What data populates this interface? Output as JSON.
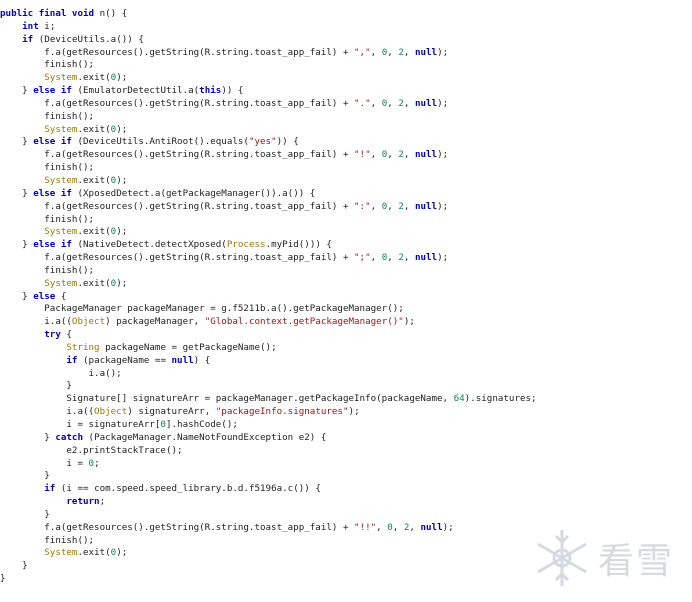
{
  "code": {
    "lines": [
      [
        {
          "t": "kw",
          "v": "public final void"
        },
        {
          "t": "fn",
          "v": " n() {"
        }
      ],
      [
        {
          "t": "fn",
          "v": "    "
        },
        {
          "t": "kw",
          "v": "int"
        },
        {
          "t": "fn",
          "v": " i;"
        }
      ],
      [
        {
          "t": "fn",
          "v": "    "
        },
        {
          "t": "kw",
          "v": "if"
        },
        {
          "t": "fn",
          "v": " (DeviceUtils.a()) {"
        }
      ],
      [
        {
          "t": "fn",
          "v": "        f.a(getResources().getString(R.string.toast_app_fail) + "
        },
        {
          "t": "str",
          "v": "\",\""
        },
        {
          "t": "fn",
          "v": ", "
        },
        {
          "t": "num",
          "v": "0"
        },
        {
          "t": "fn",
          "v": ", "
        },
        {
          "t": "num",
          "v": "2"
        },
        {
          "t": "fn",
          "v": ", "
        },
        {
          "t": "kw",
          "v": "null"
        },
        {
          "t": "fn",
          "v": ");"
        }
      ],
      [
        {
          "t": "fn",
          "v": "        finish();"
        }
      ],
      [
        {
          "t": "fn",
          "v": "        "
        },
        {
          "t": "typ",
          "v": "System"
        },
        {
          "t": "fn",
          "v": ".exit("
        },
        {
          "t": "num",
          "v": "0"
        },
        {
          "t": "fn",
          "v": ");"
        }
      ],
      [
        {
          "t": "fn",
          "v": "    } "
        },
        {
          "t": "kw",
          "v": "else if"
        },
        {
          "t": "fn",
          "v": " (EmulatorDetectUtil.a("
        },
        {
          "t": "kw",
          "v": "this"
        },
        {
          "t": "fn",
          "v": ")) {"
        }
      ],
      [
        {
          "t": "fn",
          "v": "        f.a(getResources().getString(R.string.toast_app_fail) + "
        },
        {
          "t": "str",
          "v": "\".\""
        },
        {
          "t": "fn",
          "v": ", "
        },
        {
          "t": "num",
          "v": "0"
        },
        {
          "t": "fn",
          "v": ", "
        },
        {
          "t": "num",
          "v": "2"
        },
        {
          "t": "fn",
          "v": ", "
        },
        {
          "t": "kw",
          "v": "null"
        },
        {
          "t": "fn",
          "v": ");"
        }
      ],
      [
        {
          "t": "fn",
          "v": "        finish();"
        }
      ],
      [
        {
          "t": "fn",
          "v": "        "
        },
        {
          "t": "typ",
          "v": "System"
        },
        {
          "t": "fn",
          "v": ".exit("
        },
        {
          "t": "num",
          "v": "0"
        },
        {
          "t": "fn",
          "v": ");"
        }
      ],
      [
        {
          "t": "fn",
          "v": "    } "
        },
        {
          "t": "kw",
          "v": "else if"
        },
        {
          "t": "fn",
          "v": " (DeviceUtils.AntiRoot().equals("
        },
        {
          "t": "str",
          "v": "\"yes\""
        },
        {
          "t": "fn",
          "v": ")) {"
        }
      ],
      [
        {
          "t": "fn",
          "v": "        f.a(getResources().getString(R.string.toast_app_fail) + "
        },
        {
          "t": "str",
          "v": "\"!\""
        },
        {
          "t": "fn",
          "v": ", "
        },
        {
          "t": "num",
          "v": "0"
        },
        {
          "t": "fn",
          "v": ", "
        },
        {
          "t": "num",
          "v": "2"
        },
        {
          "t": "fn",
          "v": ", "
        },
        {
          "t": "kw",
          "v": "null"
        },
        {
          "t": "fn",
          "v": ");"
        }
      ],
      [
        {
          "t": "fn",
          "v": "        finish();"
        }
      ],
      [
        {
          "t": "fn",
          "v": "        "
        },
        {
          "t": "typ",
          "v": "System"
        },
        {
          "t": "fn",
          "v": ".exit("
        },
        {
          "t": "num",
          "v": "0"
        },
        {
          "t": "fn",
          "v": ");"
        }
      ],
      [
        {
          "t": "fn",
          "v": "    } "
        },
        {
          "t": "kw",
          "v": "else if"
        },
        {
          "t": "fn",
          "v": " (XposedDetect.a(getPackageManager()).a()) {"
        }
      ],
      [
        {
          "t": "fn",
          "v": "        f.a(getResources().getString(R.string.toast_app_fail) + "
        },
        {
          "t": "str",
          "v": "\":\""
        },
        {
          "t": "fn",
          "v": ", "
        },
        {
          "t": "num",
          "v": "0"
        },
        {
          "t": "fn",
          "v": ", "
        },
        {
          "t": "num",
          "v": "2"
        },
        {
          "t": "fn",
          "v": ", "
        },
        {
          "t": "kw",
          "v": "null"
        },
        {
          "t": "fn",
          "v": ");"
        }
      ],
      [
        {
          "t": "fn",
          "v": "        finish();"
        }
      ],
      [
        {
          "t": "fn",
          "v": "        "
        },
        {
          "t": "typ",
          "v": "System"
        },
        {
          "t": "fn",
          "v": ".exit("
        },
        {
          "t": "num",
          "v": "0"
        },
        {
          "t": "fn",
          "v": ");"
        }
      ],
      [
        {
          "t": "fn",
          "v": "    } "
        },
        {
          "t": "kw",
          "v": "else if"
        },
        {
          "t": "fn",
          "v": " (NativeDetect.detectXposed("
        },
        {
          "t": "typ",
          "v": "Process"
        },
        {
          "t": "fn",
          "v": ".myPid())) {"
        }
      ],
      [
        {
          "t": "fn",
          "v": "        f.a(getResources().getString(R.string.toast_app_fail) + "
        },
        {
          "t": "str",
          "v": "\";\""
        },
        {
          "t": "fn",
          "v": ", "
        },
        {
          "t": "num",
          "v": "0"
        },
        {
          "t": "fn",
          "v": ", "
        },
        {
          "t": "num",
          "v": "2"
        },
        {
          "t": "fn",
          "v": ", "
        },
        {
          "t": "kw",
          "v": "null"
        },
        {
          "t": "fn",
          "v": ");"
        }
      ],
      [
        {
          "t": "fn",
          "v": "        finish();"
        }
      ],
      [
        {
          "t": "fn",
          "v": "        "
        },
        {
          "t": "typ",
          "v": "System"
        },
        {
          "t": "fn",
          "v": ".exit("
        },
        {
          "t": "num",
          "v": "0"
        },
        {
          "t": "fn",
          "v": ");"
        }
      ],
      [
        {
          "t": "fn",
          "v": "    } "
        },
        {
          "t": "kw",
          "v": "else"
        },
        {
          "t": "fn",
          "v": " {"
        }
      ],
      [
        {
          "t": "fn",
          "v": "        PackageManager packageManager = g.f5211b.a().getPackageManager();"
        }
      ],
      [
        {
          "t": "fn",
          "v": "        i.a(("
        },
        {
          "t": "typ",
          "v": "Object"
        },
        {
          "t": "fn",
          "v": ") packageManager, "
        },
        {
          "t": "str",
          "v": "\"Global.context.getPackageManager()\""
        },
        {
          "t": "fn",
          "v": ");"
        }
      ],
      [
        {
          "t": "fn",
          "v": "        "
        },
        {
          "t": "kw",
          "v": "try"
        },
        {
          "t": "fn",
          "v": " {"
        }
      ],
      [
        {
          "t": "fn",
          "v": "            "
        },
        {
          "t": "typ",
          "v": "String"
        },
        {
          "t": "fn",
          "v": " packageName = getPackageName();"
        }
      ],
      [
        {
          "t": "fn",
          "v": "            "
        },
        {
          "t": "kw",
          "v": "if"
        },
        {
          "t": "fn",
          "v": " (packageName == "
        },
        {
          "t": "kw",
          "v": "null"
        },
        {
          "t": "fn",
          "v": ") {"
        }
      ],
      [
        {
          "t": "fn",
          "v": "                i.a();"
        }
      ],
      [
        {
          "t": "fn",
          "v": "            }"
        }
      ],
      [
        {
          "t": "fn",
          "v": "            Signature[] signatureArr = packageManager.getPackageInfo(packageName, "
        },
        {
          "t": "num",
          "v": "64"
        },
        {
          "t": "fn",
          "v": ").signatures;"
        }
      ],
      [
        {
          "t": "fn",
          "v": "            i.a(("
        },
        {
          "t": "typ",
          "v": "Object"
        },
        {
          "t": "fn",
          "v": ") signatureArr, "
        },
        {
          "t": "str",
          "v": "\"packageInfo.signatures\""
        },
        {
          "t": "fn",
          "v": ");"
        }
      ],
      [
        {
          "t": "fn",
          "v": "            i = signatureArr["
        },
        {
          "t": "num",
          "v": "0"
        },
        {
          "t": "fn",
          "v": "].hashCode();"
        }
      ],
      [
        {
          "t": "fn",
          "v": "        } "
        },
        {
          "t": "kw",
          "v": "catch"
        },
        {
          "t": "fn",
          "v": " (PackageManager.NameNotFoundException e2) {"
        }
      ],
      [
        {
          "t": "fn",
          "v": "            e2.printStackTrace();"
        }
      ],
      [
        {
          "t": "fn",
          "v": "            i = "
        },
        {
          "t": "num",
          "v": "0"
        },
        {
          "t": "fn",
          "v": ";"
        }
      ],
      [
        {
          "t": "fn",
          "v": "        }"
        }
      ],
      [
        {
          "t": "fn",
          "v": "        "
        },
        {
          "t": "kw",
          "v": "if"
        },
        {
          "t": "fn",
          "v": " (i == com.speed.speed_library.b.d.f5196a.c()) {"
        }
      ],
      [
        {
          "t": "fn",
          "v": "            "
        },
        {
          "t": "kw",
          "v": "return"
        },
        {
          "t": "fn",
          "v": ";"
        }
      ],
      [
        {
          "t": "fn",
          "v": "        }"
        }
      ],
      [
        {
          "t": "fn",
          "v": "        f.a(getResources().getString(R.string.toast_app_fail) + "
        },
        {
          "t": "str",
          "v": "\"!!\""
        },
        {
          "t": "fn",
          "v": ", "
        },
        {
          "t": "num",
          "v": "0"
        },
        {
          "t": "fn",
          "v": ", "
        },
        {
          "t": "num",
          "v": "2"
        },
        {
          "t": "fn",
          "v": ", "
        },
        {
          "t": "kw",
          "v": "null"
        },
        {
          "t": "fn",
          "v": ");"
        }
      ],
      [
        {
          "t": "fn",
          "v": "        finish();"
        }
      ],
      [
        {
          "t": "fn",
          "v": "        "
        },
        {
          "t": "typ",
          "v": "System"
        },
        {
          "t": "fn",
          "v": ".exit("
        },
        {
          "t": "num",
          "v": "0"
        },
        {
          "t": "fn",
          "v": ");"
        }
      ],
      [
        {
          "t": "fn",
          "v": "    }"
        }
      ],
      [
        {
          "t": "fn",
          "v": "}"
        }
      ]
    ]
  },
  "watermark": {
    "text": "看雪",
    "icon": "snowflake-icon",
    "color": "#5b6f88"
  },
  "colors": {
    "keyword": "#0000cc",
    "string": "#a31515",
    "number": "#098658",
    "type": "#9a7a00",
    "text": "#1f1f1f"
  }
}
